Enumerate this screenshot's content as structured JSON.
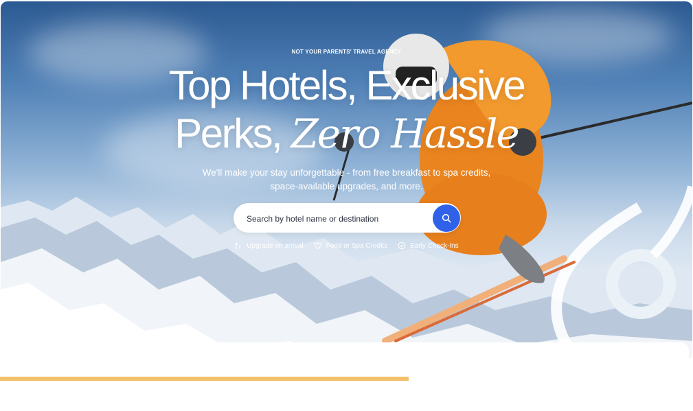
{
  "hero": {
    "eyebrow": "NOT YOUR PARENTS' TRAVEL AGENCY",
    "headline_line1": "Top Hotels, Exclusive",
    "headline_line2_plain": "Perks, ",
    "headline_line2_accent": "Zero Hassle",
    "subtitle_line1": "We'll make your stay unforgettable - from free breakfast to spa credits,",
    "subtitle_line2": "space-available upgrades, and more."
  },
  "search": {
    "placeholder": "Search by hotel name or destination",
    "button_icon": "search-icon",
    "button_color": "#2f62e8"
  },
  "perks": [
    {
      "icon": "arrow-up-icon",
      "label": "Upgrade on arrival"
    },
    {
      "icon": "heart-tag-icon",
      "label": "Food or Spa Credits"
    },
    {
      "icon": "clock-check-icon",
      "label": "Early Check-Ins"
    }
  ],
  "progress": {
    "value": 0.59,
    "color": "#f3bf68"
  }
}
